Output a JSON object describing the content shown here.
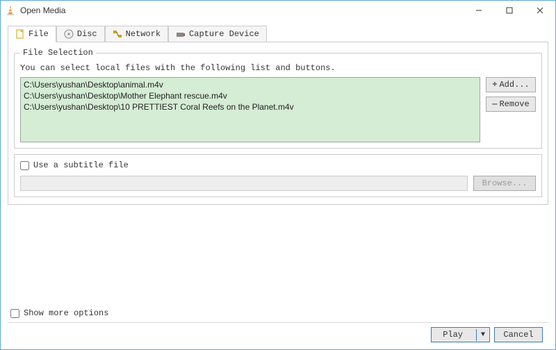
{
  "title": "Open Media",
  "tabs": [
    {
      "label": "File"
    },
    {
      "label": "Disc"
    },
    {
      "label": "Network"
    },
    {
      "label": "Capture Device"
    }
  ],
  "file_section": {
    "legend": "File Selection",
    "hint": "You can select local files with the following list and buttons.",
    "files": [
      "C:\\Users\\yushan\\Desktop\\animal.m4v",
      "C:\\Users\\yushan\\Desktop\\Mother Elephant rescue.m4v",
      "C:\\Users\\yushan\\Desktop\\10 PRETTIEST Coral Reefs on the Planet.m4v"
    ],
    "add_label": "Add...",
    "remove_label": "Remove"
  },
  "subtitle_section": {
    "checkbox_label": "Use a subtitle file",
    "browse_label": "Browse..."
  },
  "more_options_label": "Show more options",
  "footer": {
    "play_label": "Play",
    "cancel_label": "Cancel"
  }
}
